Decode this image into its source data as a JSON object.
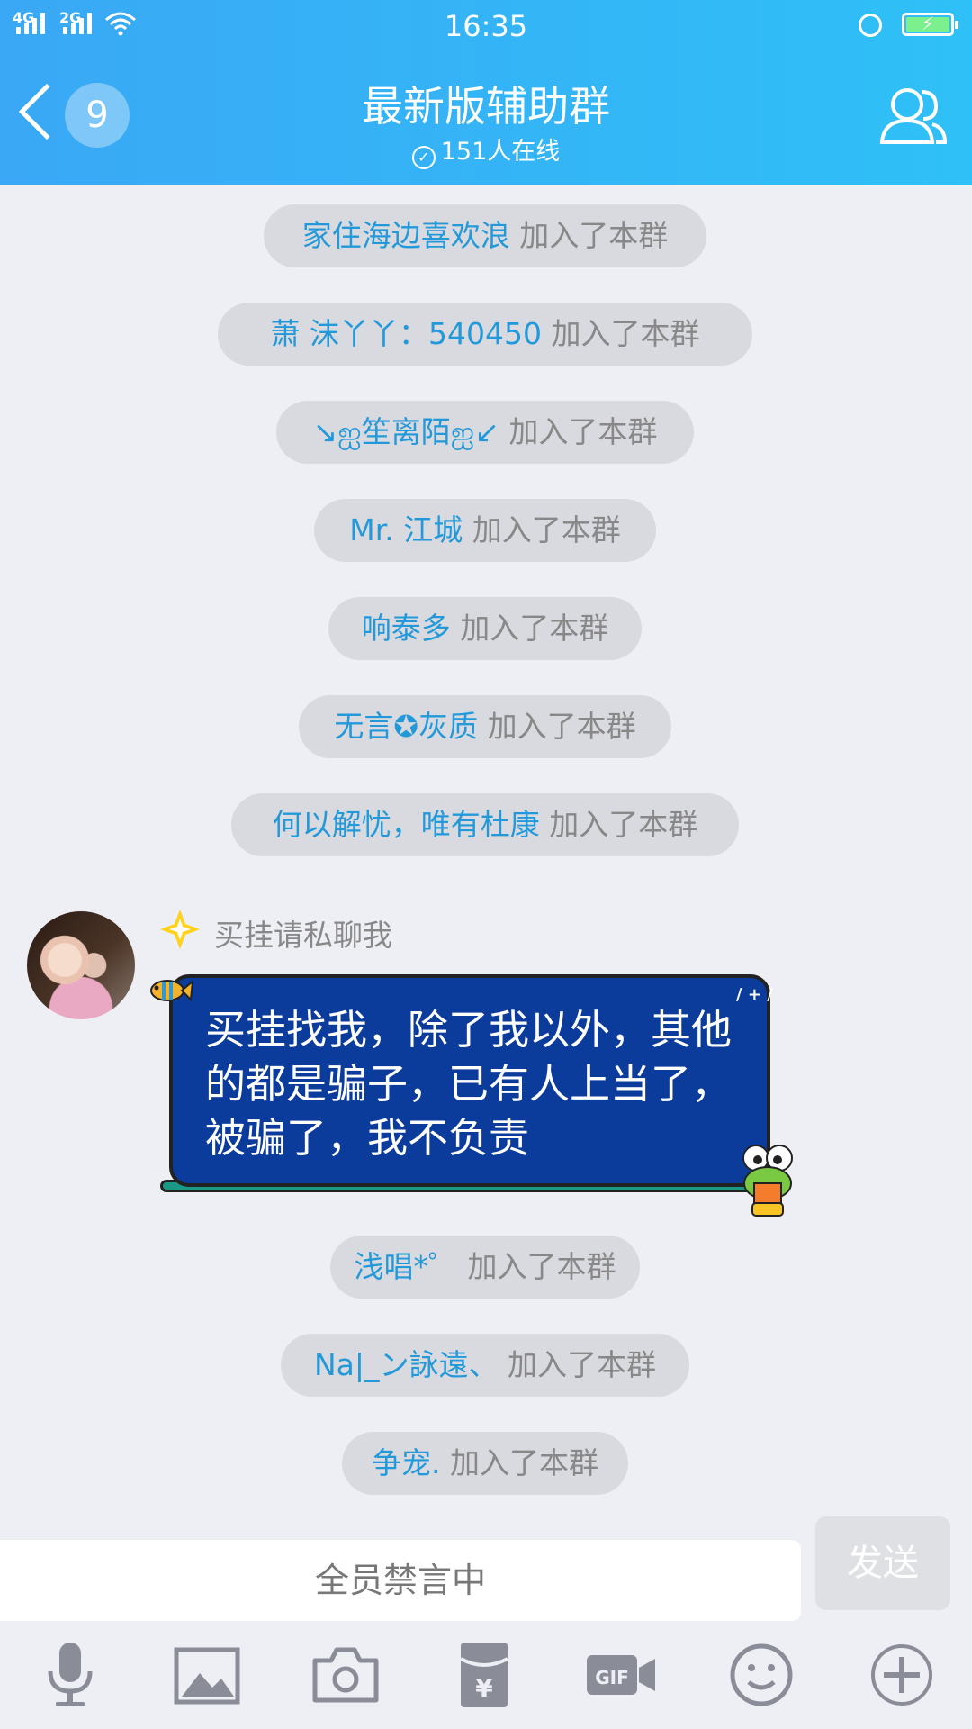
{
  "status_bar": {
    "net1": "4G",
    "net2": "2G",
    "time": "16:35"
  },
  "header": {
    "back_badge": "9",
    "title": "最新版辅助群",
    "online": "151人在线"
  },
  "join_suffix": "加入了本群",
  "joins_top": [
    "家住海边喜欢浪",
    "萧  沫丫丫：540450",
    "↘ஐ笙离陌ஐ↙",
    "Mr. 江城",
    "响泰多",
    "无言✪灰质",
    "何以解忧，唯有杜康"
  ],
  "message": {
    "sender": "买挂请私聊我",
    "text": "买挂找我，除了我以外，其他的都是骗子，已有人上当了，被骗了，我不负责"
  },
  "joins_bottom": [
    "浅唱*゜",
    "Na|_ン詠遠、",
    "争宠."
  ],
  "input": {
    "placeholder": "全员禁言中",
    "send_label": "发送"
  },
  "toolbar": [
    "mic-icon",
    "image-icon",
    "camera-icon",
    "red-packet-icon",
    "gif-icon",
    "emoji-icon",
    "plus-icon"
  ],
  "colors": {
    "header": "#3aa8f5",
    "name_link": "#2399d9",
    "bubble": "#0b3c9c"
  }
}
